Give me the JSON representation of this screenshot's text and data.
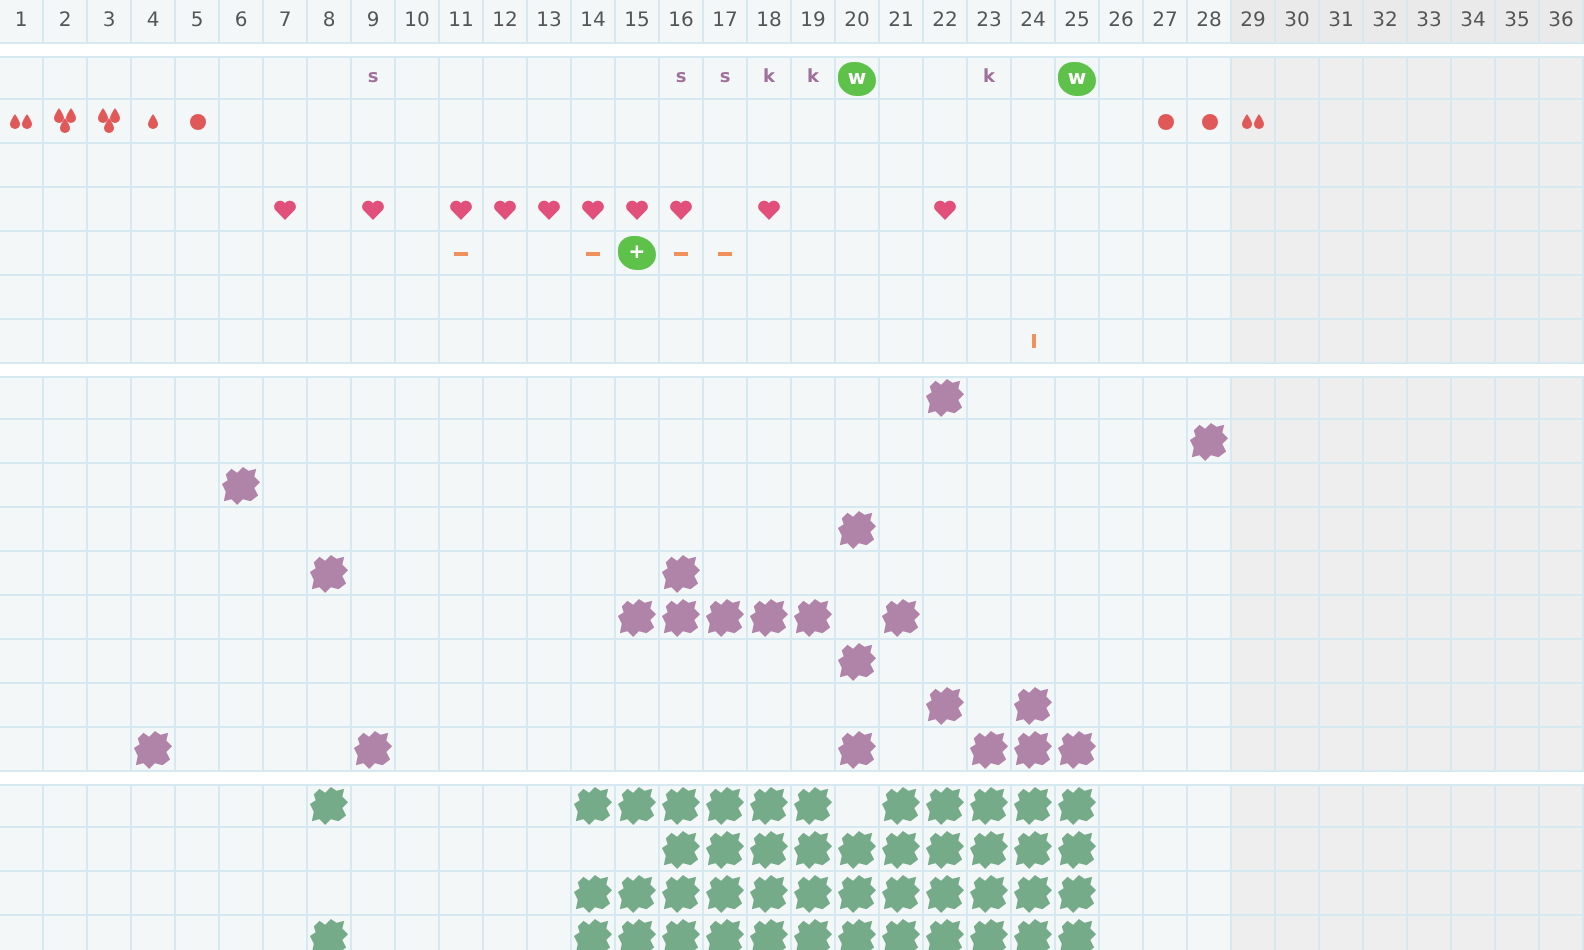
{
  "days": [
    {
      "label": "1",
      "disabled": false
    },
    {
      "label": "2",
      "disabled": false
    },
    {
      "label": "3",
      "disabled": false
    },
    {
      "label": "4",
      "disabled": false
    },
    {
      "label": "5",
      "disabled": false
    },
    {
      "label": "6",
      "disabled": false
    },
    {
      "label": "7",
      "disabled": false
    },
    {
      "label": "8",
      "disabled": false
    },
    {
      "label": "9",
      "disabled": false
    },
    {
      "label": "10",
      "disabled": false
    },
    {
      "label": "11",
      "disabled": false
    },
    {
      "label": "12",
      "disabled": false
    },
    {
      "label": "13",
      "disabled": false
    },
    {
      "label": "14",
      "disabled": false
    },
    {
      "label": "15",
      "disabled": false
    },
    {
      "label": "16",
      "disabled": false
    },
    {
      "label": "17",
      "disabled": false
    },
    {
      "label": "18",
      "disabled": false
    },
    {
      "label": "19",
      "disabled": false
    },
    {
      "label": "20",
      "disabled": false
    },
    {
      "label": "21",
      "disabled": false
    },
    {
      "label": "22",
      "disabled": false
    },
    {
      "label": "23",
      "disabled": false
    },
    {
      "label": "24",
      "disabled": false
    },
    {
      "label": "25",
      "disabled": false
    },
    {
      "label": "26",
      "disabled": false
    },
    {
      "label": "27",
      "disabled": false
    },
    {
      "label": "28",
      "disabled": false
    },
    {
      "label": "29",
      "disabled": true
    },
    {
      "label": "30",
      "disabled": true
    },
    {
      "label": "31",
      "disabled": true
    },
    {
      "label": "32",
      "disabled": true
    },
    {
      "label": "33",
      "disabled": true
    },
    {
      "label": "34",
      "disabled": true
    },
    {
      "label": "35",
      "disabled": true
    },
    {
      "label": "36",
      "disabled": true
    }
  ],
  "symbol_rows": [
    {
      "cells": [
        {},
        {},
        {},
        {},
        {},
        {},
        {},
        {},
        {
          "kind": "letter",
          "text": "s"
        },
        {},
        {},
        {},
        {},
        {},
        {},
        {
          "kind": "letter",
          "text": "s"
        },
        {
          "kind": "letter",
          "text": "s"
        },
        {
          "kind": "letter",
          "text": "k"
        },
        {
          "kind": "letter",
          "text": "k"
        },
        {
          "kind": "badge",
          "text": "w"
        },
        {},
        {},
        {
          "kind": "letter",
          "text": "k"
        },
        {},
        {
          "kind": "badge",
          "text": "w"
        }
      ]
    },
    {
      "cells": [
        {
          "kind": "drops-two"
        },
        {
          "kind": "drops-three"
        },
        {
          "kind": "drops-three"
        },
        {
          "kind": "drop"
        },
        {
          "kind": "dot"
        },
        {},
        {},
        {},
        {},
        {},
        {},
        {},
        {},
        {},
        {},
        {},
        {},
        {},
        {},
        {},
        {},
        {},
        {},
        {},
        {},
        {},
        {
          "kind": "dot"
        },
        {
          "kind": "dot"
        },
        {
          "kind": "drops-two"
        }
      ]
    },
    {},
    {
      "cells": [
        {},
        {},
        {},
        {},
        {},
        {},
        {
          "kind": "heart"
        },
        {},
        {
          "kind": "heart"
        },
        {},
        {
          "kind": "heart"
        },
        {
          "kind": "heart"
        },
        {
          "kind": "heart"
        },
        {
          "kind": "heart"
        },
        {
          "kind": "heart"
        },
        {
          "kind": "heart"
        },
        {},
        {
          "kind": "heart"
        },
        {},
        {},
        {},
        {
          "kind": "heart"
        }
      ]
    },
    {
      "cells": [
        {},
        {},
        {},
        {},
        {},
        {},
        {},
        {},
        {},
        {},
        {
          "kind": "dash"
        },
        {},
        {},
        {
          "kind": "dash"
        },
        {
          "kind": "badge",
          "text": "+"
        },
        {
          "kind": "dash"
        },
        {
          "kind": "dash"
        }
      ]
    },
    {},
    {
      "cells": [
        {},
        {},
        {},
        {},
        {},
        {},
        {},
        {},
        {},
        {},
        {},
        {},
        {},
        {},
        {},
        {},
        {},
        {},
        {},
        {},
        {},
        {},
        {},
        {
          "kind": "bar"
        }
      ]
    }
  ],
  "sections": [
    {
      "color": "#b083a8",
      "rows": [
        {
          "filled": [
            false,
            false,
            false,
            false,
            false,
            false,
            false,
            false,
            false,
            false,
            false,
            false,
            false,
            false,
            false,
            false,
            false,
            false,
            false,
            false,
            false,
            true
          ]
        },
        {
          "filled": [
            false,
            false,
            false,
            false,
            false,
            false,
            false,
            false,
            false,
            false,
            false,
            false,
            false,
            false,
            false,
            false,
            false,
            false,
            false,
            false,
            false,
            false,
            false,
            false,
            false,
            false,
            false,
            true
          ]
        },
        {
          "filled": [
            false,
            false,
            false,
            false,
            false,
            true
          ]
        },
        {
          "filled": [
            false,
            false,
            false,
            false,
            false,
            false,
            false,
            false,
            false,
            false,
            false,
            false,
            false,
            false,
            false,
            false,
            false,
            false,
            false,
            true
          ]
        },
        {
          "filled": [
            false,
            false,
            false,
            false,
            false,
            false,
            false,
            true,
            false,
            false,
            false,
            false,
            false,
            false,
            false,
            true
          ]
        },
        {
          "filled": [
            false,
            false,
            false,
            false,
            false,
            false,
            false,
            false,
            false,
            false,
            false,
            false,
            false,
            false,
            true,
            true,
            true,
            true,
            true,
            false,
            true
          ]
        },
        {
          "filled": [
            false,
            false,
            false,
            false,
            false,
            false,
            false,
            false,
            false,
            false,
            false,
            false,
            false,
            false,
            false,
            false,
            false,
            false,
            false,
            true
          ]
        },
        {
          "filled": [
            false,
            false,
            false,
            false,
            false,
            false,
            false,
            false,
            false,
            false,
            false,
            false,
            false,
            false,
            false,
            false,
            false,
            false,
            false,
            false,
            false,
            true,
            false,
            true
          ]
        },
        {
          "filled": [
            false,
            false,
            false,
            true,
            false,
            false,
            false,
            false,
            true,
            false,
            false,
            false,
            false,
            false,
            false,
            false,
            false,
            false,
            false,
            true,
            false,
            false,
            true,
            true,
            true
          ]
        }
      ]
    },
    {
      "color": "#76ab8a",
      "rows": [
        {
          "filled": [
            false,
            false,
            false,
            false,
            false,
            false,
            false,
            true,
            false,
            false,
            false,
            false,
            false,
            true,
            true,
            true,
            true,
            true,
            true,
            false,
            true,
            true,
            true,
            true,
            true
          ]
        },
        {
          "filled": [
            false,
            false,
            false,
            false,
            false,
            false,
            false,
            false,
            false,
            false,
            false,
            false,
            false,
            false,
            false,
            true,
            true,
            true,
            true,
            true,
            true,
            true,
            true,
            true,
            true
          ]
        },
        {
          "filled": [
            false,
            false,
            false,
            false,
            false,
            false,
            false,
            false,
            false,
            false,
            false,
            false,
            false,
            true,
            true,
            true,
            true,
            true,
            true,
            true,
            true,
            true,
            true,
            true,
            true
          ]
        },
        {
          "filled": [
            false,
            false,
            false,
            false,
            false,
            false,
            false,
            true,
            false,
            false,
            false,
            false,
            false,
            true,
            true,
            true,
            true,
            true,
            true,
            true,
            true,
            true,
            true,
            true,
            true
          ]
        }
      ]
    }
  ]
}
